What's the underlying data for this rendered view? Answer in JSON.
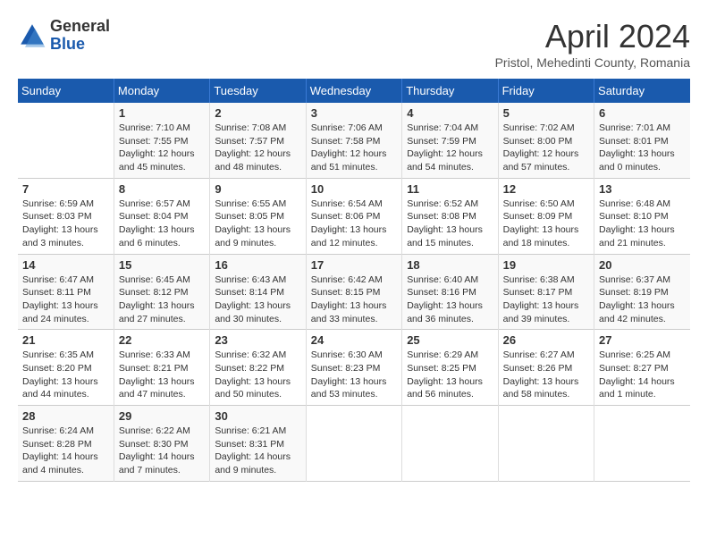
{
  "header": {
    "logo_general": "General",
    "logo_blue": "Blue",
    "month_title": "April 2024",
    "location": "Pristol, Mehedinti County, Romania"
  },
  "days_of_week": [
    "Sunday",
    "Monday",
    "Tuesday",
    "Wednesday",
    "Thursday",
    "Friday",
    "Saturday"
  ],
  "weeks": [
    [
      {
        "day": "",
        "info": ""
      },
      {
        "day": "1",
        "info": "Sunrise: 7:10 AM\nSunset: 7:55 PM\nDaylight: 12 hours\nand 45 minutes."
      },
      {
        "day": "2",
        "info": "Sunrise: 7:08 AM\nSunset: 7:57 PM\nDaylight: 12 hours\nand 48 minutes."
      },
      {
        "day": "3",
        "info": "Sunrise: 7:06 AM\nSunset: 7:58 PM\nDaylight: 12 hours\nand 51 minutes."
      },
      {
        "day": "4",
        "info": "Sunrise: 7:04 AM\nSunset: 7:59 PM\nDaylight: 12 hours\nand 54 minutes."
      },
      {
        "day": "5",
        "info": "Sunrise: 7:02 AM\nSunset: 8:00 PM\nDaylight: 12 hours\nand 57 minutes."
      },
      {
        "day": "6",
        "info": "Sunrise: 7:01 AM\nSunset: 8:01 PM\nDaylight: 13 hours\nand 0 minutes."
      }
    ],
    [
      {
        "day": "7",
        "info": "Sunrise: 6:59 AM\nSunset: 8:03 PM\nDaylight: 13 hours\nand 3 minutes."
      },
      {
        "day": "8",
        "info": "Sunrise: 6:57 AM\nSunset: 8:04 PM\nDaylight: 13 hours\nand 6 minutes."
      },
      {
        "day": "9",
        "info": "Sunrise: 6:55 AM\nSunset: 8:05 PM\nDaylight: 13 hours\nand 9 minutes."
      },
      {
        "day": "10",
        "info": "Sunrise: 6:54 AM\nSunset: 8:06 PM\nDaylight: 13 hours\nand 12 minutes."
      },
      {
        "day": "11",
        "info": "Sunrise: 6:52 AM\nSunset: 8:08 PM\nDaylight: 13 hours\nand 15 minutes."
      },
      {
        "day": "12",
        "info": "Sunrise: 6:50 AM\nSunset: 8:09 PM\nDaylight: 13 hours\nand 18 minutes."
      },
      {
        "day": "13",
        "info": "Sunrise: 6:48 AM\nSunset: 8:10 PM\nDaylight: 13 hours\nand 21 minutes."
      }
    ],
    [
      {
        "day": "14",
        "info": "Sunrise: 6:47 AM\nSunset: 8:11 PM\nDaylight: 13 hours\nand 24 minutes."
      },
      {
        "day": "15",
        "info": "Sunrise: 6:45 AM\nSunset: 8:12 PM\nDaylight: 13 hours\nand 27 minutes."
      },
      {
        "day": "16",
        "info": "Sunrise: 6:43 AM\nSunset: 8:14 PM\nDaylight: 13 hours\nand 30 minutes."
      },
      {
        "day": "17",
        "info": "Sunrise: 6:42 AM\nSunset: 8:15 PM\nDaylight: 13 hours\nand 33 minutes."
      },
      {
        "day": "18",
        "info": "Sunrise: 6:40 AM\nSunset: 8:16 PM\nDaylight: 13 hours\nand 36 minutes."
      },
      {
        "day": "19",
        "info": "Sunrise: 6:38 AM\nSunset: 8:17 PM\nDaylight: 13 hours\nand 39 minutes."
      },
      {
        "day": "20",
        "info": "Sunrise: 6:37 AM\nSunset: 8:19 PM\nDaylight: 13 hours\nand 42 minutes."
      }
    ],
    [
      {
        "day": "21",
        "info": "Sunrise: 6:35 AM\nSunset: 8:20 PM\nDaylight: 13 hours\nand 44 minutes."
      },
      {
        "day": "22",
        "info": "Sunrise: 6:33 AM\nSunset: 8:21 PM\nDaylight: 13 hours\nand 47 minutes."
      },
      {
        "day": "23",
        "info": "Sunrise: 6:32 AM\nSunset: 8:22 PM\nDaylight: 13 hours\nand 50 minutes."
      },
      {
        "day": "24",
        "info": "Sunrise: 6:30 AM\nSunset: 8:23 PM\nDaylight: 13 hours\nand 53 minutes."
      },
      {
        "day": "25",
        "info": "Sunrise: 6:29 AM\nSunset: 8:25 PM\nDaylight: 13 hours\nand 56 minutes."
      },
      {
        "day": "26",
        "info": "Sunrise: 6:27 AM\nSunset: 8:26 PM\nDaylight: 13 hours\nand 58 minutes."
      },
      {
        "day": "27",
        "info": "Sunrise: 6:25 AM\nSunset: 8:27 PM\nDaylight: 14 hours\nand 1 minute."
      }
    ],
    [
      {
        "day": "28",
        "info": "Sunrise: 6:24 AM\nSunset: 8:28 PM\nDaylight: 14 hours\nand 4 minutes."
      },
      {
        "day": "29",
        "info": "Sunrise: 6:22 AM\nSunset: 8:30 PM\nDaylight: 14 hours\nand 7 minutes."
      },
      {
        "day": "30",
        "info": "Sunrise: 6:21 AM\nSunset: 8:31 PM\nDaylight: 14 hours\nand 9 minutes."
      },
      {
        "day": "",
        "info": ""
      },
      {
        "day": "",
        "info": ""
      },
      {
        "day": "",
        "info": ""
      },
      {
        "day": "",
        "info": ""
      }
    ]
  ]
}
